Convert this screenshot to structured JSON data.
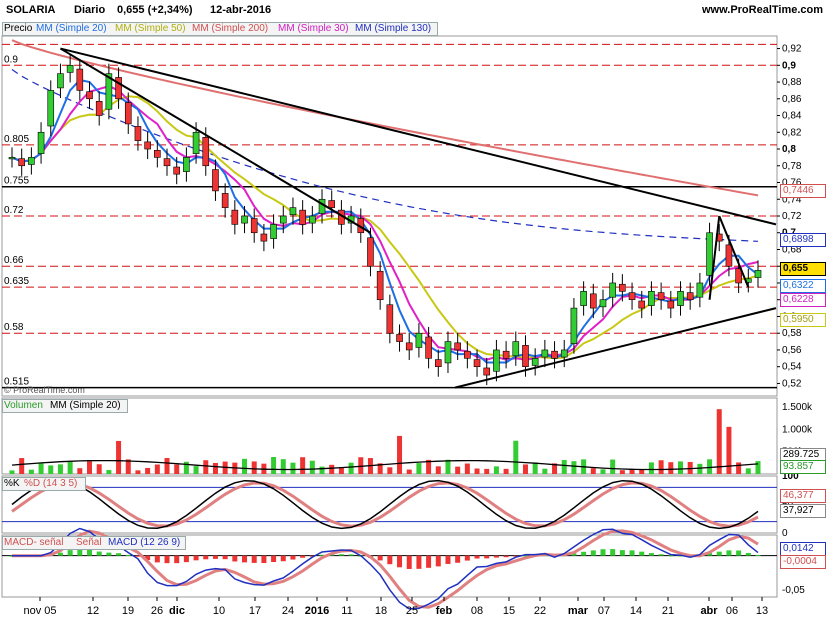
{
  "header": {
    "symbol": "SOLARIA",
    "period": "Diario",
    "last": "0,655 (+2,34%)",
    "date": "12-abr-2016",
    "site": "www.ProRealTime.com"
  },
  "legends": {
    "price": [
      "Precio",
      "MM (Simple 20)",
      "MM (Simple 50)",
      "MM (Simple 200)",
      "MM (Simple 30)",
      "MM (Simple 130)"
    ],
    "volume": [
      "Volumen",
      "MM (Simple 20)"
    ],
    "stoch": [
      "%K",
      "%D (14 3 5)"
    ],
    "macd": [
      "MACD- señal",
      "Señal",
      "MACD (12 26 9)"
    ]
  },
  "watermark": "© ProRealTime.com",
  "tags": {
    "price": [
      "0,7446",
      "0,6898",
      "0,655",
      "0,6322",
      "0,6228",
      "0,5950"
    ],
    "volume": [
      "289.725",
      "93.857"
    ],
    "stoch": [
      "46,377",
      "37,927"
    ],
    "macd": [
      "0,0142",
      "-0,0004"
    ]
  },
  "colors": {
    "up": "#33cc33",
    "down": "#ee3333",
    "ma20": "#1e6fe6",
    "ma50": "#c8c814",
    "ma200": "#e07070",
    "ma30": "#e020c8",
    "ma130": "#2030c0",
    "hline_red": "#d01010",
    "trend": "#000000"
  },
  "chart_data": [
    {
      "type": "candlestick",
      "title": "Precio",
      "ylim": [
        0.505,
        0.935
      ],
      "y_ticks": [
        "0,92",
        "0,9",
        "0,88",
        "0,86",
        "0,84",
        "0,82",
        "0,8",
        "0,78",
        "0,76",
        "0,74",
        "0,72",
        "0,7",
        "0,68",
        "0,66",
        "0,64",
        "0,62",
        "0,6",
        "0,58",
        "0,56",
        "0,54",
        "0,52"
      ],
      "left_level_labels": [
        "0.9",
        "0.805",
        "0.755",
        "0.72",
        "0.66",
        "0.635",
        "0.58",
        "0.515"
      ],
      "x_ticks": [
        "nov 05",
        "12",
        "19",
        "26",
        "dic",
        "10",
        "17",
        "24",
        "2016",
        "11",
        "18",
        "25",
        "feb",
        "08",
        "15",
        "22",
        "mar",
        "07",
        "14",
        "21",
        "abr",
        "06",
        "13"
      ],
      "dashed_levels": [
        0.925,
        0.9,
        0.805,
        0.72,
        0.66,
        0.635,
        0.58
      ],
      "solid_levels": [
        0.755,
        0.515
      ],
      "close_sample": [
        0.79,
        0.78,
        0.79,
        0.82,
        0.87,
        0.89,
        0.9,
        0.87,
        0.86,
        0.84,
        0.89,
        0.86,
        0.83,
        0.81,
        0.8,
        0.79,
        0.78,
        0.77,
        0.79,
        0.82,
        0.78,
        0.75,
        0.73,
        0.71,
        0.72,
        0.7,
        0.69,
        0.71,
        0.72,
        0.73,
        0.71,
        0.72,
        0.74,
        0.73,
        0.71,
        0.72,
        0.7,
        0.66,
        0.62,
        0.58,
        0.57,
        0.56,
        0.58,
        0.55,
        0.54,
        0.57,
        0.56,
        0.55,
        0.54,
        0.53,
        0.56,
        0.55,
        0.57,
        0.54,
        0.55,
        0.56,
        0.55,
        0.56,
        0.61,
        0.63,
        0.61,
        0.62,
        0.64,
        0.63,
        0.62,
        0.61,
        0.63,
        0.62,
        0.61,
        0.63,
        0.62,
        0.64,
        0.7,
        0.69,
        0.66,
        0.64,
        0.645,
        0.655
      ],
      "series": [
        {
          "name": "MM (Simple 20)",
          "last": 0.6322
        },
        {
          "name": "MM (Simple 50)",
          "last": 0.595
        },
        {
          "name": "MM (Simple 200)",
          "last": 0.7446
        },
        {
          "name": "MM (Simple 30)",
          "last": 0.6228
        },
        {
          "name": "MM (Simple 130)",
          "last": 0.6898
        }
      ],
      "last": 0.655
    },
    {
      "type": "bar",
      "title": "Volumen",
      "ylim": [
        0,
        1700000
      ],
      "y_ticks": [
        "1.500k",
        "1.000k",
        "500k"
      ],
      "series": [
        {
          "name": "MM (Simple 20)",
          "last": 289725
        }
      ],
      "last": 93857
    },
    {
      "type": "line",
      "title": "%K %D (14 3 5)",
      "ylim": [
        0,
        100
      ],
      "y_ticks": [
        "100",
        "50",
        "0"
      ],
      "last_k": 37.927,
      "last_d": 46.377
    },
    {
      "type": "line",
      "title": "MACD (12 26 9)",
      "ylim": [
        -0.06,
        0.03
      ],
      "y_ticks": [
        "0",
        "-0,05"
      ],
      "last_macd": 0.0142,
      "last_signal": -0.0004
    }
  ]
}
